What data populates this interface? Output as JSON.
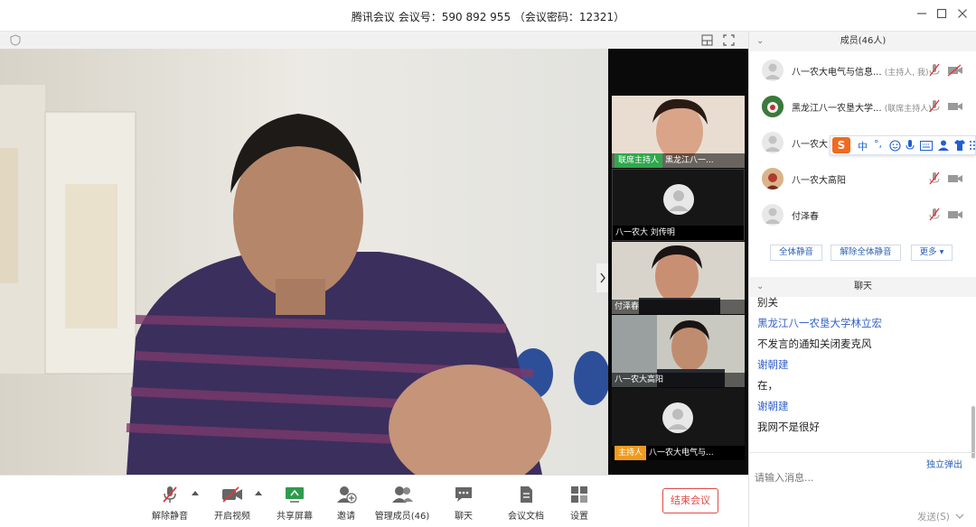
{
  "window": {
    "title": "腾讯会议 会议号：590 892 955 （会议密码：12321）",
    "minimize_icon": "minimize-icon",
    "maximize_icon": "maximize-icon",
    "close_icon": "close-icon"
  },
  "thumbnails": [
    {
      "host_tag": "联席主持人",
      "name": "黑龙江八一..."
    },
    {
      "host_tag": "",
      "name": "八一农大 刘传明"
    },
    {
      "host_tag": "",
      "name": "付泽春"
    },
    {
      "host_tag": "",
      "name": "八一农大高阳"
    },
    {
      "host_tag": "主持人",
      "name": "八一农大电气与..."
    }
  ],
  "toolbar": {
    "mute_label": "解除静音",
    "video_label": "开启视频",
    "share_label": "共享屏幕",
    "invite_label": "邀请",
    "members_label": "管理成员(46)",
    "chat_label": "聊天",
    "docs_label": "会议文档",
    "settings_label": "设置",
    "end_label": "结束会议"
  },
  "members_panel": {
    "title": "成员(46人)",
    "members": [
      {
        "name": "八一农大电气与信息...",
        "role": "(主持人, 我)"
      },
      {
        "name": "黑龙江八一农垦大学...",
        "role": "(联席主持人)"
      },
      {
        "name": "八一农大",
        "role": ""
      },
      {
        "name": "八一农大高阳",
        "role": ""
      },
      {
        "name": "付泽春",
        "role": ""
      }
    ],
    "mute_all": "全体静音",
    "unmute_all": "解除全体静音",
    "more": "更多 ▾"
  },
  "chat_panel": {
    "title": "聊天",
    "messages": [
      {
        "kind": "msg",
        "text": "别关"
      },
      {
        "kind": "name",
        "text": "黑龙江八一农垦大学林立宏"
      },
      {
        "kind": "msg",
        "text": "不发言的通知关闭麦克风"
      },
      {
        "kind": "name",
        "text": "谢朝建"
      },
      {
        "kind": "msg",
        "text": "在，"
      },
      {
        "kind": "name",
        "text": "谢朝建"
      },
      {
        "kind": "msg",
        "text": "我网不是很好"
      }
    ],
    "popout": "独立弹出",
    "placeholder": "请输入消息...",
    "send": "发送(S)"
  },
  "ime_toolbar": {
    "logo": "S",
    "mode": "中",
    "punct": "°,"
  }
}
